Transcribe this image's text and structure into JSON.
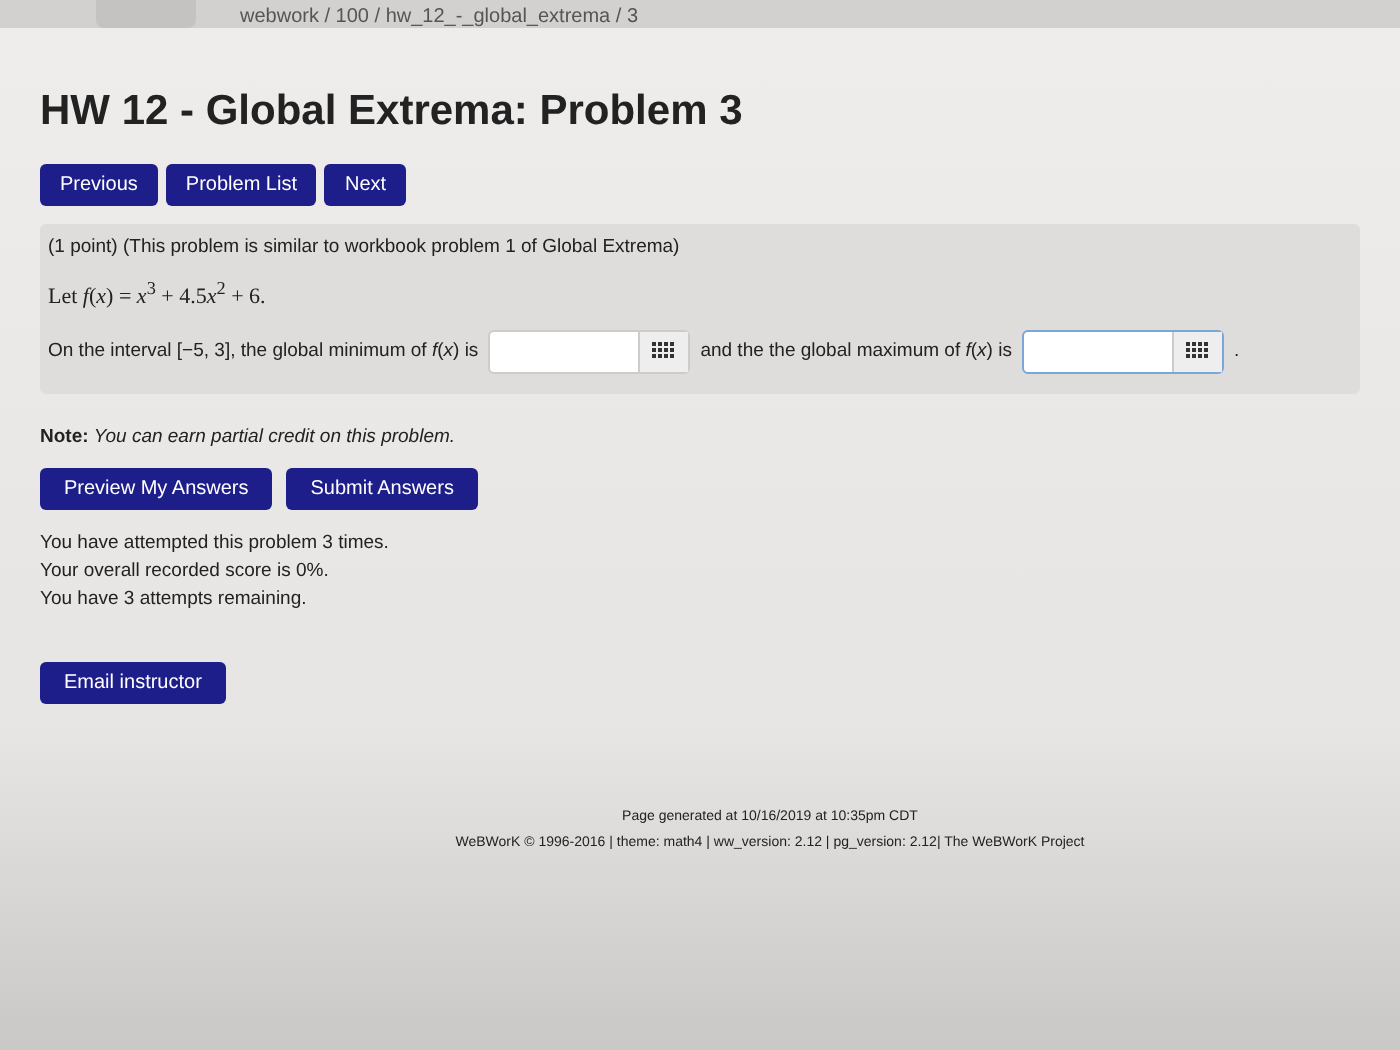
{
  "breadcrumb": "webwork / 100 / hw_12_-_global_extrema / 3",
  "title": "HW 12 - Global Extrema: Problem 3",
  "nav_buttons": [
    "Previous",
    "Problem List",
    "Next"
  ],
  "problem": {
    "header": "(1 point) (This problem is similar to workbook problem 1 of Global Extrema)",
    "statement": [
      {
        "text": "Let ",
        "kind": "plain"
      },
      {
        "text": "f",
        "kind": "var"
      },
      {
        "text": "(",
        "kind": "plain"
      },
      {
        "text": "x",
        "kind": "var"
      },
      {
        "text": ") = ",
        "kind": "plain"
      },
      {
        "text": "x",
        "kind": "var"
      },
      {
        "text": "3",
        "kind": "sup"
      },
      {
        "text": " + 4.5",
        "kind": "plain"
      },
      {
        "text": "x",
        "kind": "var"
      },
      {
        "text": "2",
        "kind": "sup"
      },
      {
        "text": " + 6.",
        "kind": "plain"
      }
    ],
    "question_start": "On the interval [−5, 3], the global minimum of *f*(*x*) is",
    "question_middle": "and the the global maximum of *f*(*x*) is",
    "question_end": ".",
    "answers": [
      {
        "focused": false
      },
      {
        "focused": true
      }
    ]
  },
  "note_label": "Note:",
  "note_text": "You can earn partial credit on this problem.",
  "action_buttons": [
    "Preview My Answers",
    "Submit Answers"
  ],
  "status_lines": [
    "You have attempted this problem 3 times.",
    "Your overall recorded score is 0%.",
    "You have 3 attempts remaining."
  ],
  "email_button": "Email instructor",
  "footer": [
    "Page generated at 10/16/2019 at 10:35pm CDT",
    "WeBWorK © 1996-2016 | theme: math4 | ww_version: 2.12 | pg_version: 2.12| The WeBWorK Project"
  ]
}
